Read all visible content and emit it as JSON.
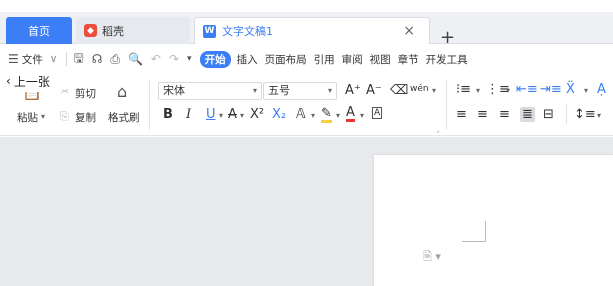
{
  "tabs": {
    "home": "首页",
    "daoke": "稻壳",
    "doc": "文字文稿1",
    "close": "×",
    "add": "+"
  },
  "menu": {
    "file": "文件",
    "start": "开始",
    "items": [
      "插入",
      "页面布局",
      "引用",
      "审阅",
      "视图",
      "章节",
      "开发工具"
    ]
  },
  "nav": {
    "prev_page": "上一张"
  },
  "toolbar": {
    "paste": "粘贴",
    "cut": "剪切",
    "copy": "复制",
    "format_painter": "格式刷",
    "font_name": "宋体",
    "font_size": "五号",
    "bold": "B",
    "italic": "I",
    "underline": "U",
    "superscript": "X²",
    "subscript": "X₂",
    "pinyin": "wén"
  }
}
